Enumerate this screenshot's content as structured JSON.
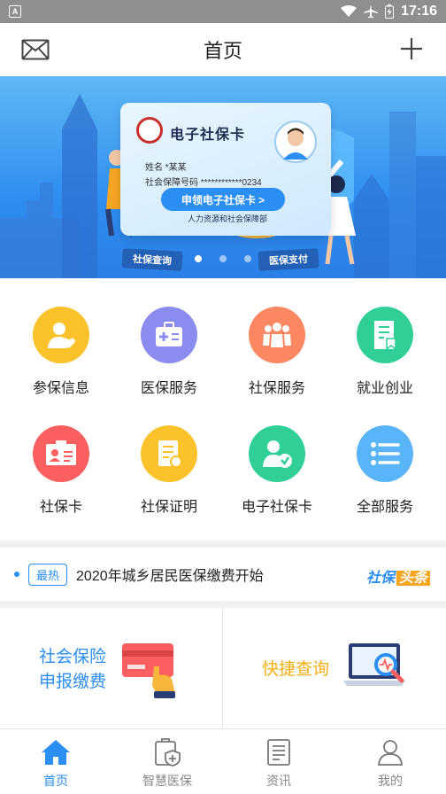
{
  "status_bar": {
    "app_badge": "A",
    "time": "17:16"
  },
  "header": {
    "title": "首页",
    "left_icon": "mail-icon",
    "right_icon": "plus-icon"
  },
  "banner": {
    "card_title": "电子社保卡",
    "name_line": "姓名  *某某",
    "number_line": "社会保障号码  ************0234",
    "apply_button": "申领电子社保卡  >",
    "department": "人力资源和社会保障部",
    "tag_left": "社保查询",
    "tag_right": "医保支付",
    "slide_count": 3,
    "active_slide": 1
  },
  "services": [
    {
      "label": "参保信息",
      "color": "#fbc22b",
      "icon": "person-heart-icon"
    },
    {
      "label": "医保服务",
      "color": "#8c8cf0",
      "icon": "medical-kit-icon"
    },
    {
      "label": "社保服务",
      "color": "#fc8761",
      "icon": "group-people-icon"
    },
    {
      "label": "就业创业",
      "color": "#2fcf96",
      "icon": "document-bookmark-icon"
    },
    {
      "label": "社保卡",
      "color": "#fb5f5f",
      "icon": "id-card-icon"
    },
    {
      "label": "社保证明",
      "color": "#fbc22b",
      "icon": "certificate-icon"
    },
    {
      "label": "电子社保卡",
      "color": "#2fcf96",
      "icon": "person-verified-icon"
    },
    {
      "label": "全部服务",
      "color": "#5ab4f8",
      "icon": "list-icon"
    }
  ],
  "news": {
    "badge": "最热",
    "headline": "2020年城乡居民医保缴费开始",
    "brand_a": "社保",
    "brand_b": "头条"
  },
  "quick": {
    "left_line1": "社会保险",
    "left_line2": "申报缴费",
    "right_label": "快捷查询"
  },
  "tabs": [
    {
      "label": "首页",
      "icon": "home-icon",
      "active": true
    },
    {
      "label": "智慧医保",
      "icon": "medical-shield-icon",
      "active": false
    },
    {
      "label": "资讯",
      "icon": "news-document-icon",
      "active": false
    },
    {
      "label": "我的",
      "icon": "user-icon",
      "active": false
    }
  ]
}
